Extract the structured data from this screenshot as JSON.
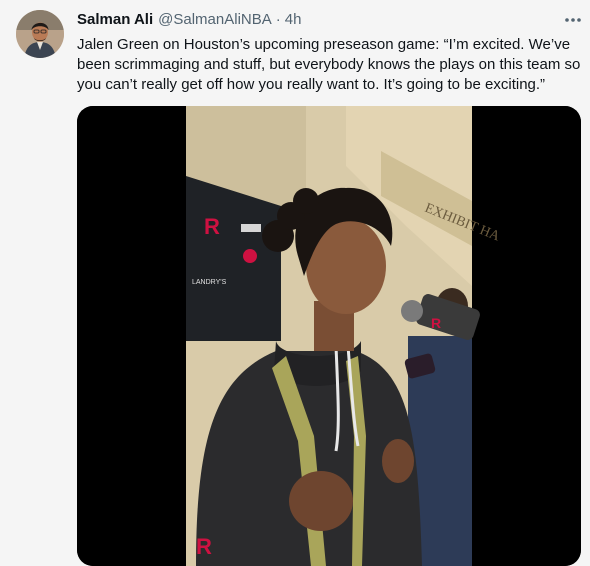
{
  "tweet": {
    "author": {
      "display_name": "Salman Ali",
      "handle": "@SalmanAliNBA",
      "separator": "·",
      "time": "4h"
    },
    "text": "Jalen Green on Houston’s upcoming preseason game: “I’m excited. We’ve been scrimmaging and stuff, but everybody knows the plays on this team so you can’t really get off how you really want to. It’s going to be exciting.”",
    "more_icon": "more-horizontal-icon",
    "media": {
      "type": "video",
      "backdrop_text": "EXHIBIT HA",
      "logo_glyph": "R",
      "sponsor_texts": [
        "LANDRY'S"
      ]
    }
  },
  "colors": {
    "background": "#f5f5f5",
    "text_primary": "#0f1419",
    "text_secondary": "#536471",
    "media_bg": "#000000",
    "rockets_red": "#ce1141",
    "hoodie": "#2b2b2d",
    "straps": "#a9a55a"
  }
}
